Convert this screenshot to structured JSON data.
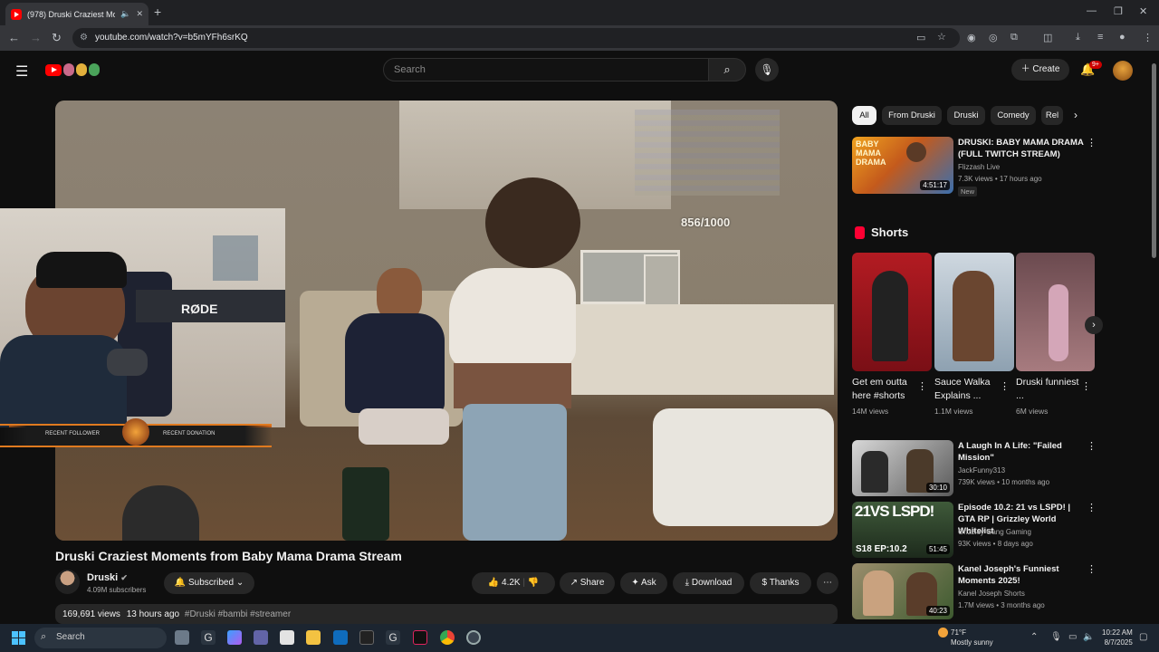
{
  "browser": {
    "tab_title": "(978) Druski Craziest Mome",
    "url": "youtube.com/watch?v=b5mYFh6srKQ"
  },
  "header": {
    "search_placeholder": "Search",
    "create_label": "Create",
    "notification_count": "9+"
  },
  "video": {
    "overlay_counter": "856/1000",
    "title": "Druski Craziest Moments from Baby Mama Drama Stream",
    "channel": "Druski",
    "subscribers": "4.09M subscribers",
    "subscribed_label": "Subscribed",
    "likes": "4.2K",
    "actions": [
      "Share",
      "Ask",
      "Download",
      "Thanks"
    ],
    "views": "169,691 views",
    "age": "13 hours ago",
    "tags": "#Druski #bambi #streamer",
    "webcam_logo": "RØDE",
    "webcam_bar_left": "RECENT FOLLOWER",
    "webcam_bar_right": "RECENT DONATION"
  },
  "sidebar": {
    "chips": [
      "All",
      "From Druski",
      "Druski",
      "Comedy",
      "Rel"
    ],
    "first_rec": {
      "title": "DRUSKI: BABY MAMA DRAMA (FULL TWITCH STREAM)",
      "channel": "Flizzash Live",
      "meta": "7.3K views • 17 hours ago",
      "duration": "4:51:17",
      "badge": "New",
      "thumb_text": "BABY MAMA DRAMA"
    },
    "shorts_heading": "Shorts",
    "shorts": [
      {
        "title": "Get em outta here #shorts",
        "views": "14M views"
      },
      {
        "title": "Sauce Walka Explains ...",
        "views": "1.1M views"
      },
      {
        "title": "Druski funniest ...",
        "views": "6M views"
      }
    ],
    "recs": [
      {
        "title": "A Laugh In A Life: \"Failed Mission\"",
        "channel": "JackFunny313",
        "meta": "739K views • 10 months ago",
        "duration": "30:10"
      },
      {
        "title": "Episode 10.2: 21 vs LSPD! | GTA RP | Grizzley World Whitelist",
        "channel": "Grizzley Gang Gaming",
        "meta": "93K views • 8 days ago",
        "duration": "51:45",
        "thumb_text": "21VS LSPD!",
        "thumb_sub": "S18 EP:10.2"
      },
      {
        "title": "Kanel Joseph's Funniest Moments 2025!",
        "channel": "Kanel Joseph Shorts",
        "meta": "1.7M views • 3 months ago",
        "duration": "40:23"
      }
    ]
  },
  "taskbar": {
    "search_label": "Search",
    "weather_temp": "71°F",
    "weather_desc": "Mostly sunny",
    "time": "10:22 AM",
    "date": "8/7/2025"
  },
  "colors": {
    "yt_red": "#ff0000",
    "background": "#0f0f0f",
    "chip_bg": "#272727"
  }
}
